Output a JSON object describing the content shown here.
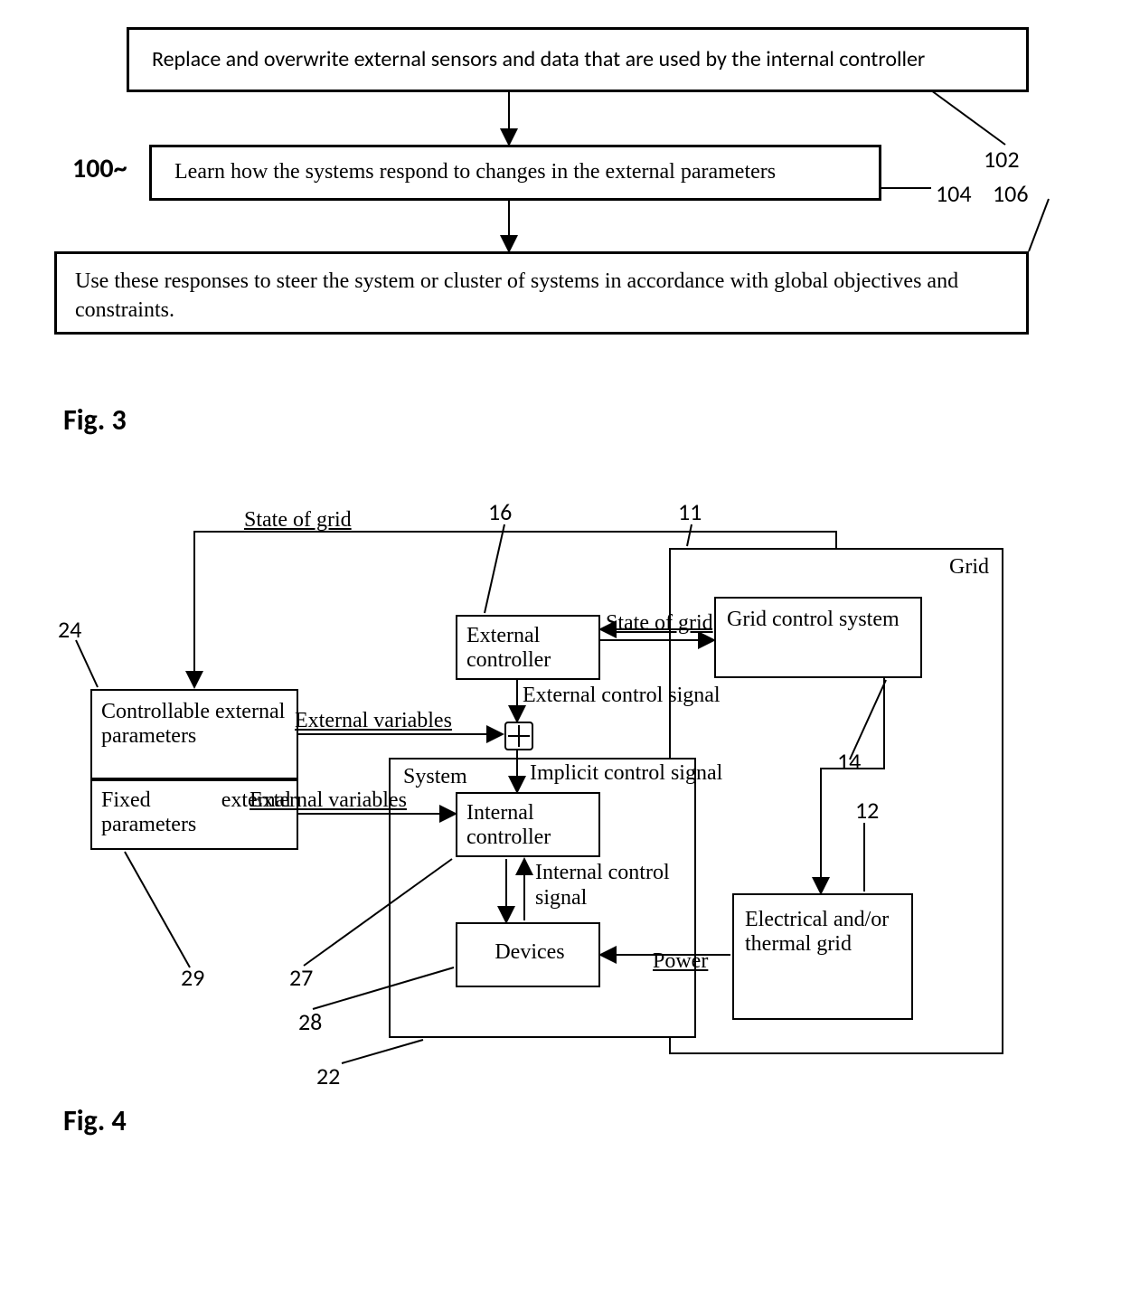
{
  "fig3": {
    "caption": "Fig. 3",
    "ref_100": "100~",
    "ref_102": "102",
    "ref_104": "104",
    "ref_106": "106",
    "step1": "Replace and overwrite external sensors and data that are used by the internal controller",
    "step2": "Learn how the systems respond to changes in the external parameters",
    "step3": "Use these responses to steer the system or cluster of systems in accordance with global objectives and constraints."
  },
  "fig4": {
    "caption": "Fig. 4",
    "ref": {
      "r11": "11",
      "r12": "12",
      "r14": "14",
      "r16": "16",
      "r22": "22",
      "r24": "24",
      "r27": "27",
      "r28": "28",
      "r29": "29"
    },
    "labels": {
      "grid": "Grid",
      "state_of_grid": "State of grid",
      "state_of_grid2": "State of grid",
      "grid_control_system": "Grid control system",
      "external_controller": "External controller",
      "external_control_signal": "External control signal",
      "external_variables": "External variables",
      "external_variables2": "External variables",
      "controllable_external_parameters": "Controllable external parameters",
      "fixed_external_parameters": "Fixed external parameters",
      "implicit_control_signal": "Implicit control signal",
      "system": "System",
      "internal_controller": "Internal controller",
      "internal_control_signal": "Internal control signal",
      "devices": "Devices",
      "power": "Power",
      "electrical_thermal_grid": "Electrical and/or thermal grid"
    }
  }
}
